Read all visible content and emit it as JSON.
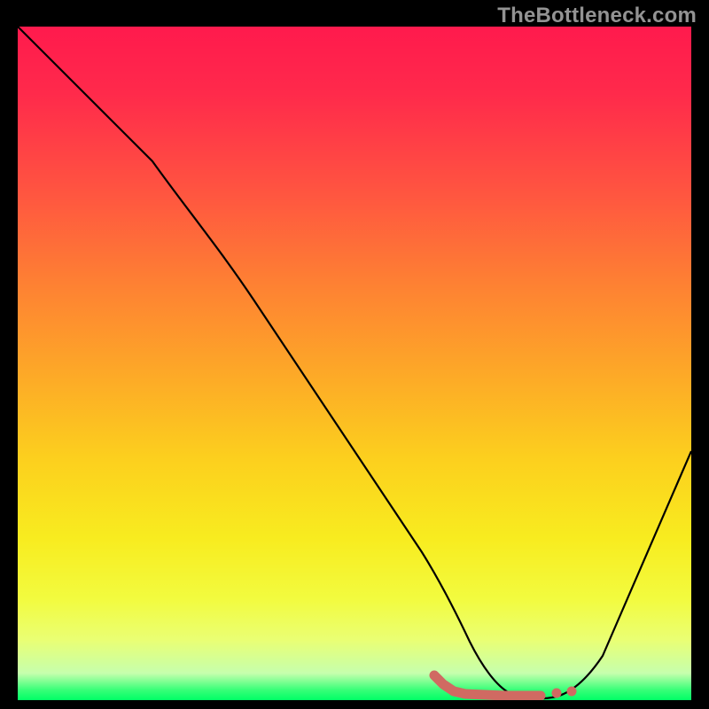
{
  "watermark": "TheBottleneck.com",
  "chart_data": {
    "type": "line",
    "title": "",
    "xlabel": "",
    "ylabel": "",
    "xlim": [
      0,
      100
    ],
    "ylim": [
      0,
      100
    ],
    "grid": false,
    "legend": false,
    "series": [
      {
        "name": "main-curve",
        "color": "#000000",
        "x": [
          0,
          10,
          20,
          30,
          40,
          50,
          60,
          65,
          70,
          75,
          80,
          85,
          90,
          95,
          100
        ],
        "y": [
          100,
          90,
          80,
          67,
          52,
          37,
          22,
          14,
          7,
          2,
          0,
          2,
          10,
          22,
          38
        ]
      },
      {
        "name": "valley-highlight",
        "color": "#d06a62",
        "x": [
          61,
          63,
          65,
          67,
          70,
          73,
          76,
          78,
          80,
          82
        ],
        "y": [
          3.0,
          2.0,
          1.3,
          0.9,
          0.6,
          0.6,
          0.6,
          0.6,
          0.9,
          0.9
        ]
      }
    ],
    "gradient_stops": [
      {
        "pos": 0.0,
        "color": "#ff1a4d"
      },
      {
        "pos": 0.25,
        "color": "#ff5640"
      },
      {
        "pos": 0.5,
        "color": "#fda928"
      },
      {
        "pos": 0.75,
        "color": "#f9ec1f"
      },
      {
        "pos": 0.96,
        "color": "#c6ffad"
      },
      {
        "pos": 1.0,
        "color": "#00ff66"
      }
    ]
  }
}
